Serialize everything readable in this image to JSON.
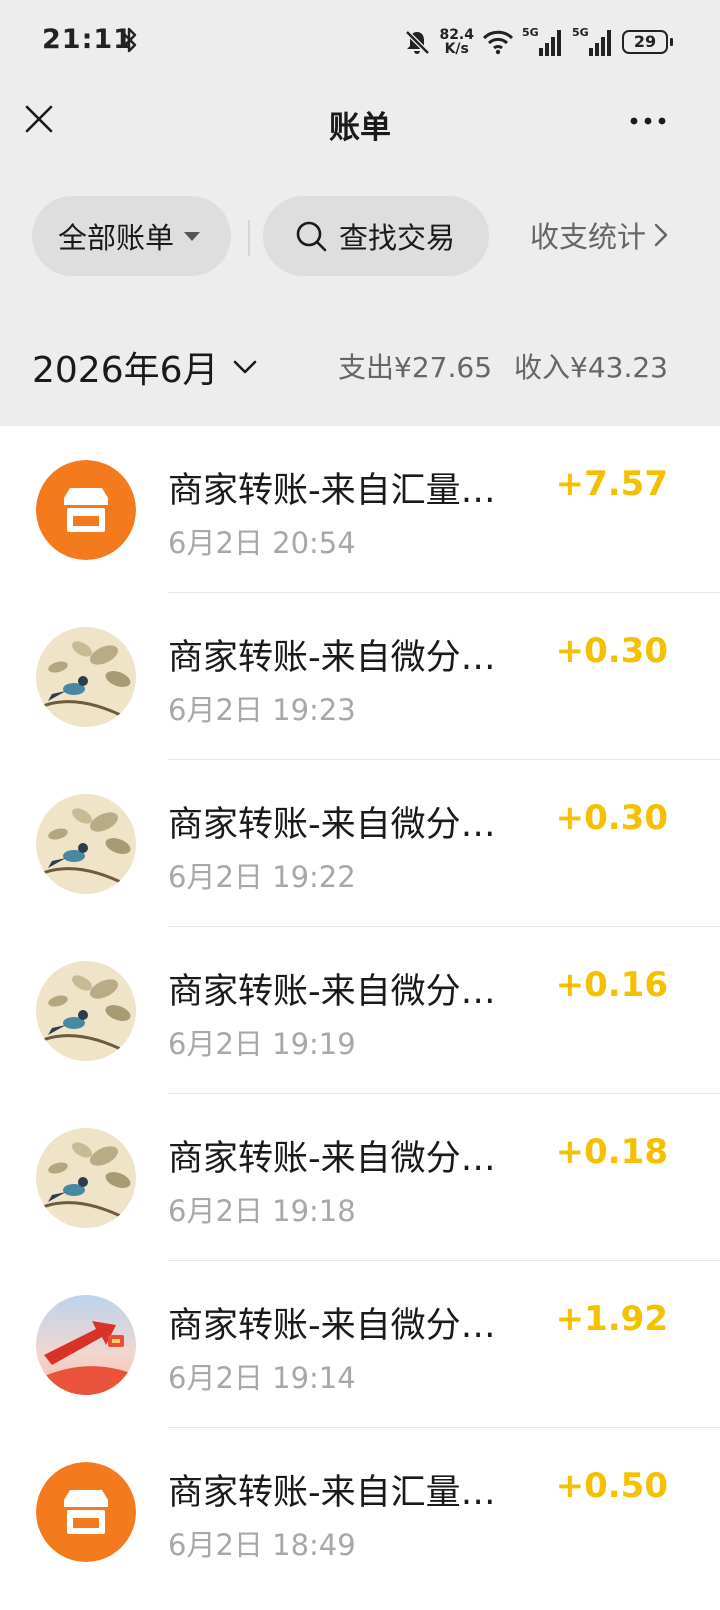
{
  "status_bar": {
    "time": "21:11",
    "net_speed_value": "82.4",
    "net_speed_unit": "K/s",
    "signal_label_1": "5G",
    "signal_label_2": "5G",
    "battery": "29"
  },
  "nav": {
    "title": "账单",
    "close_icon": "close-icon",
    "more_icon": "more-icon"
  },
  "filters": {
    "all_bills": "全部账单",
    "search": "查找交易",
    "stats": "收支统计"
  },
  "month": {
    "label": "2026年6月",
    "expense": "支出¥27.65",
    "income": "收入¥43.23"
  },
  "colors": {
    "amount": "#f5c000",
    "shop_avatar": "#f37b1d",
    "background": "#ededed"
  },
  "transactions": [
    {
      "title": "商家转账-来自汇量…",
      "time": "6月2日 20:54",
      "amount": "+7.57",
      "avatar": "shop-icon"
    },
    {
      "title": "商家转账-来自微分…",
      "time": "6月2日 19:23",
      "amount": "+0.30",
      "avatar": "bird-painting"
    },
    {
      "title": "商家转账-来自微分…",
      "time": "6月2日 19:22",
      "amount": "+0.30",
      "avatar": "bird-painting"
    },
    {
      "title": "商家转账-来自微分…",
      "time": "6月2日 19:19",
      "amount": "+0.16",
      "avatar": "bird-painting"
    },
    {
      "title": "商家转账-来自微分…",
      "time": "6月2日 19:18",
      "amount": "+0.18",
      "avatar": "bird-painting"
    },
    {
      "title": "商家转账-来自微分…",
      "time": "6月2日 19:14",
      "amount": "+1.92",
      "avatar": "red-arrow-image"
    },
    {
      "title": "商家转账-来自汇量…",
      "time": "6月2日 18:49",
      "amount": "+0.50",
      "avatar": "shop-icon"
    }
  ]
}
